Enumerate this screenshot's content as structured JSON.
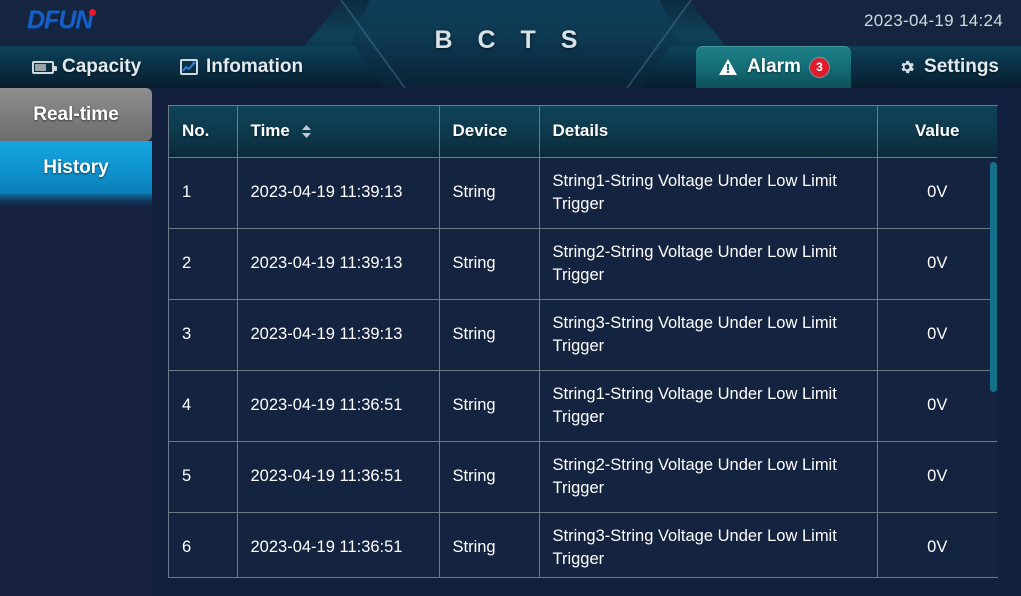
{
  "header": {
    "logo_text": "DFUN",
    "logo_dot_color": "#e8192c",
    "app_title": "B C T S",
    "datetime": "2023-04-19 14:24"
  },
  "nav": {
    "capacity_label": "Capacity",
    "capacity_icon": "battery-icon",
    "information_label": "Infomation",
    "information_icon": "chart-icon",
    "alarm_label": "Alarm",
    "alarm_icon": "warning-triangle-icon",
    "alarm_badge": "3",
    "alarm_badge_color": "#e21b28",
    "alarm_active_color": "#157079",
    "settings_label": "Settings",
    "settings_icon": "gear-icon"
  },
  "sidebar": {
    "items": [
      {
        "label": "Real-time",
        "state": "active",
        "color": "#7c7c7c"
      },
      {
        "label": "History",
        "state": "default",
        "color": "#0f93cf"
      }
    ]
  },
  "table": {
    "columns": [
      {
        "key": "no",
        "label": "No."
      },
      {
        "key": "time",
        "label": "Time",
        "sortable": true,
        "sort_icon": "sort-updown-icon"
      },
      {
        "key": "device",
        "label": "Device"
      },
      {
        "key": "details",
        "label": "Details"
      },
      {
        "key": "value",
        "label": "Value"
      }
    ],
    "rows": [
      {
        "no": "1",
        "time": "2023-04-19 11:39:13",
        "device": "String",
        "details": "String1-String Voltage Under Low Limit Trigger",
        "value": "0V"
      },
      {
        "no": "2",
        "time": "2023-04-19 11:39:13",
        "device": "String",
        "details": "String2-String Voltage Under Low Limit Trigger",
        "value": "0V"
      },
      {
        "no": "3",
        "time": "2023-04-19 11:39:13",
        "device": "String",
        "details": "String3-String Voltage Under Low Limit Trigger",
        "value": "0V"
      },
      {
        "no": "4",
        "time": "2023-04-19 11:36:51",
        "device": "String",
        "details": "String1-String Voltage Under Low Limit Trigger",
        "value": "0V"
      },
      {
        "no": "5",
        "time": "2023-04-19 11:36:51",
        "device": "String",
        "details": "String2-String Voltage Under Low Limit Trigger",
        "value": "0V"
      },
      {
        "no": "6",
        "time": "2023-04-19 11:36:51",
        "device": "String",
        "details": "String3-String Voltage Under Low Limit Trigger",
        "value": "0V"
      }
    ]
  },
  "scrollbar": {
    "thumb_color": "#157089"
  }
}
